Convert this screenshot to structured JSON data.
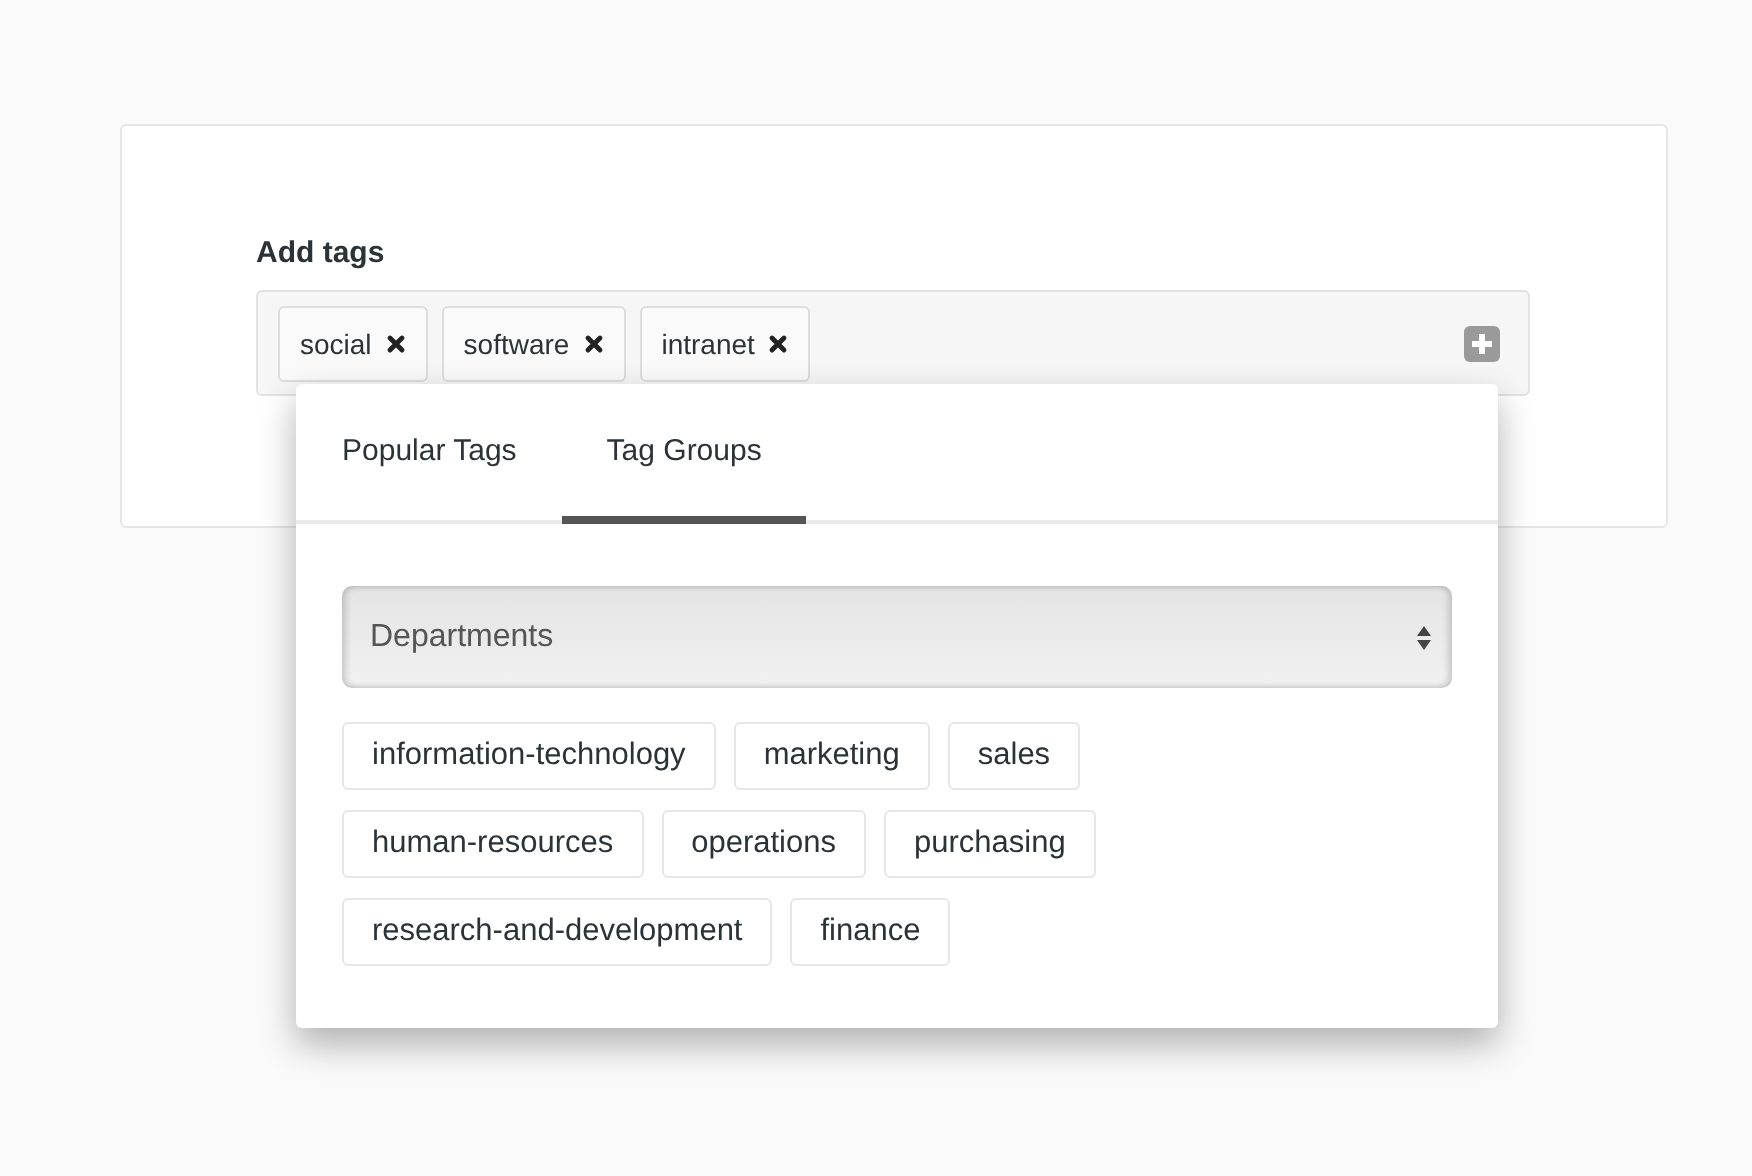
{
  "label": "Add tags",
  "selected_tags": [
    "social",
    "software",
    "intranet"
  ],
  "dropdown": {
    "tabs": [
      {
        "label": "Popular Tags",
        "selected": false
      },
      {
        "label": "Tag Groups",
        "selected": true
      }
    ],
    "group_select": {
      "value": "Departments"
    },
    "tags": [
      "information-technology",
      "marketing",
      "sales",
      "human-resources",
      "operations",
      "purchasing",
      "research-and-development",
      "finance"
    ]
  }
}
